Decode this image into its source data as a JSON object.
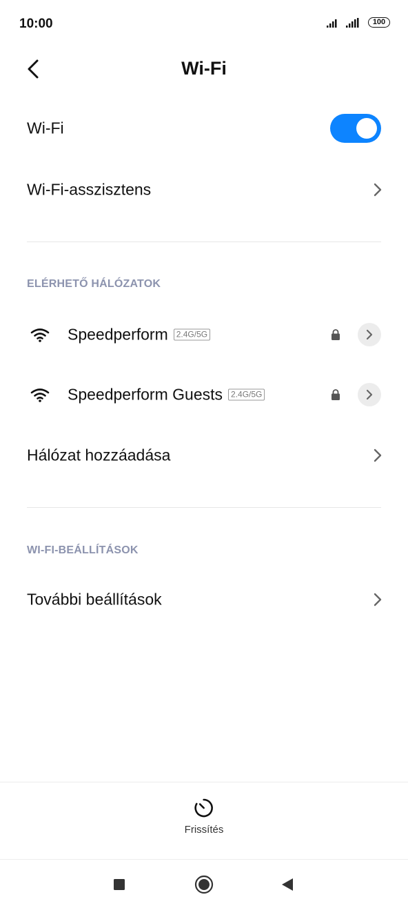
{
  "status_bar": {
    "time": "10:00",
    "battery": "100"
  },
  "header": {
    "title": "Wi-Fi"
  },
  "wifi_toggle": {
    "label": "Wi-Fi",
    "state": "on",
    "accent_color": "#0d84ff"
  },
  "assistant": {
    "label": "Wi-Fi-asszisztens"
  },
  "available_networks": {
    "header": "ELÉRHETŐ HÁLÓZATOK",
    "networks": [
      {
        "name": "Speedperform",
        "band": "2.4G/5G",
        "secured": true
      },
      {
        "name": "Speedperform Guests",
        "band": "2.4G/5G",
        "secured": true
      }
    ],
    "add_network_label": "Hálózat hozzáadása"
  },
  "wifi_settings": {
    "header": "WI-FI-BEÁLLÍTÁSOK",
    "more_settings_label": "További beállítások"
  },
  "bottom_bar": {
    "refresh_label": "Frissítés"
  },
  "nav_bar": {
    "icons": [
      "square-recents-icon",
      "circle-home-icon",
      "triangle-back-icon"
    ]
  }
}
